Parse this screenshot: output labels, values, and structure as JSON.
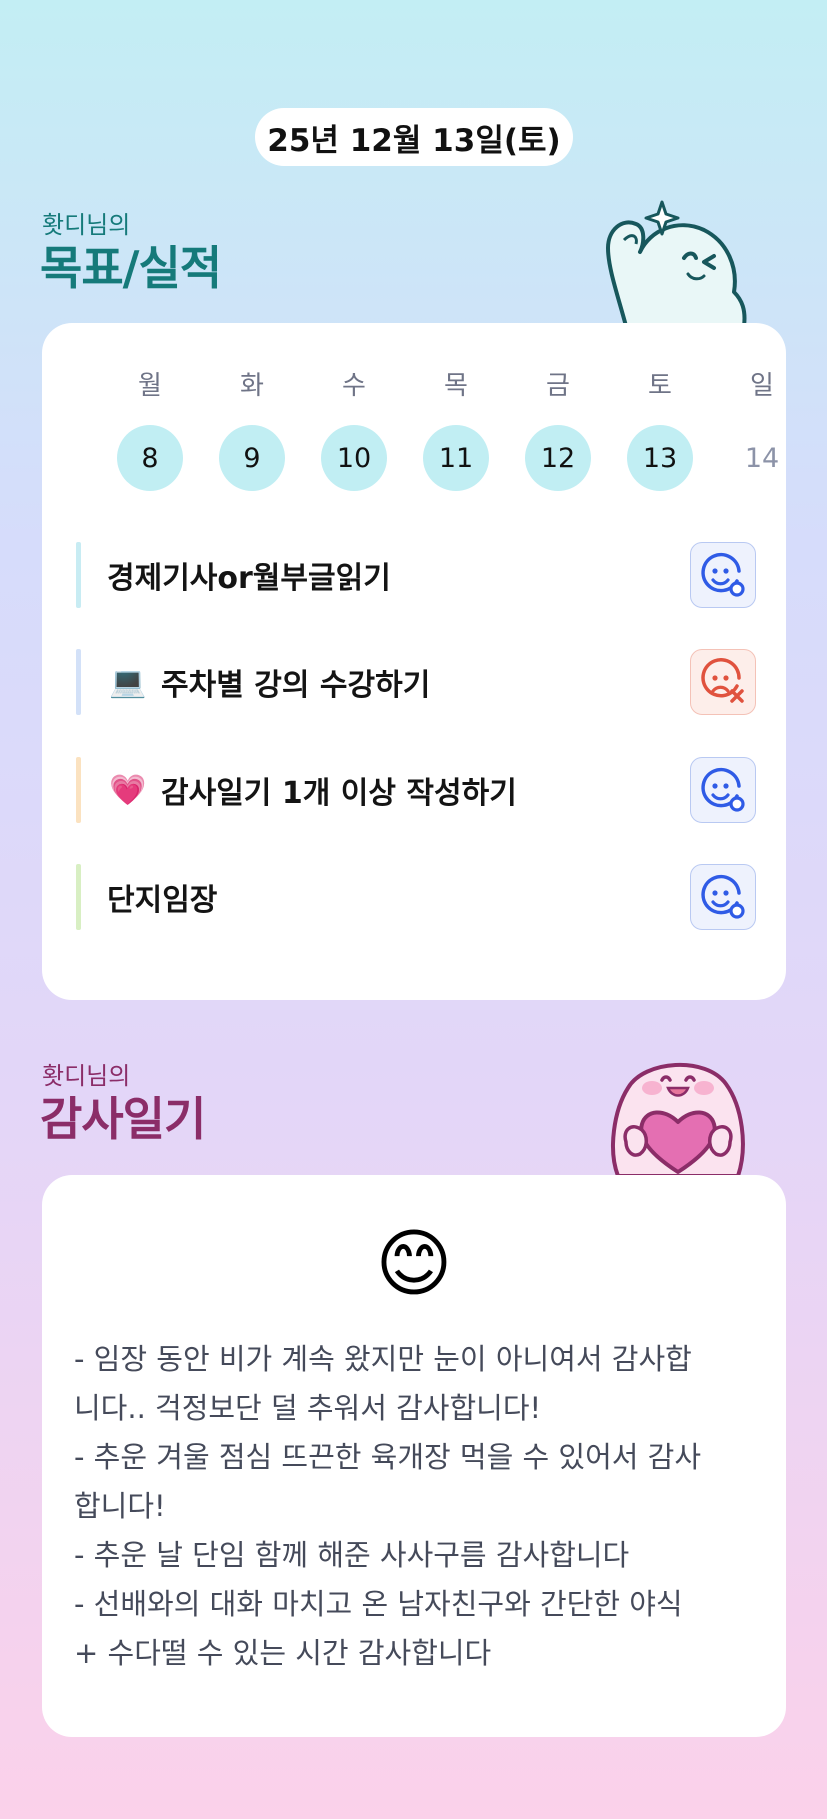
{
  "header": {
    "date": "25년 12월 13일(토)"
  },
  "goals_section": {
    "subtitle": "홧디님의",
    "title": "목표/실적",
    "week": {
      "days": [
        "월",
        "화",
        "수",
        "목",
        "금",
        "토",
        "일"
      ],
      "dates": [
        "8",
        "9",
        "10",
        "11",
        "12",
        "13",
        "14"
      ],
      "active": [
        true,
        true,
        true,
        true,
        true,
        true,
        false
      ]
    },
    "goals": [
      {
        "text": "경제기사or월부글읽기",
        "emoji": "",
        "bar_color": "#c8ecf3",
        "status": "achieved"
      },
      {
        "text": "주차별 강의 수강하기",
        "emoji": "💻",
        "bar_color": "#d3e1f8",
        "status": "missed"
      },
      {
        "text": "감사일기 1개 이상 작성하기",
        "emoji": "💗",
        "bar_color": "#fbe2c0",
        "status": "achieved"
      },
      {
        "text": "단지임장",
        "emoji": "",
        "bar_color": "#d8efc3",
        "status": "achieved"
      }
    ],
    "colors": {
      "accent": "#157a7a",
      "date_circle": "#c1eef3",
      "achieved_icon": "#2f5be6",
      "missed_icon": "#e0523e"
    }
  },
  "gratitude_section": {
    "subtitle": "홧디님의",
    "title": "감사일기",
    "emoji": "😊",
    "lines": [
      "- 임장 동안 비가 계속 왔지만 눈이 아니여서 감사합",
      "니다.. 걱정보단 덜 추워서 감사합니다!",
      "- 추운 겨울 점심 뜨끈한 육개장 먹을 수 있어서 감사",
      "합니다!",
      "- 추운 날 단임 함께 해준 사사구름 감사합니다",
      "- 선배와의 대화 마치고 온 남자친구와 간단한 야식",
      "+ 수다떨 수 있는 시간 감사합니다"
    ],
    "colors": {
      "accent": "#8b2d68"
    }
  }
}
